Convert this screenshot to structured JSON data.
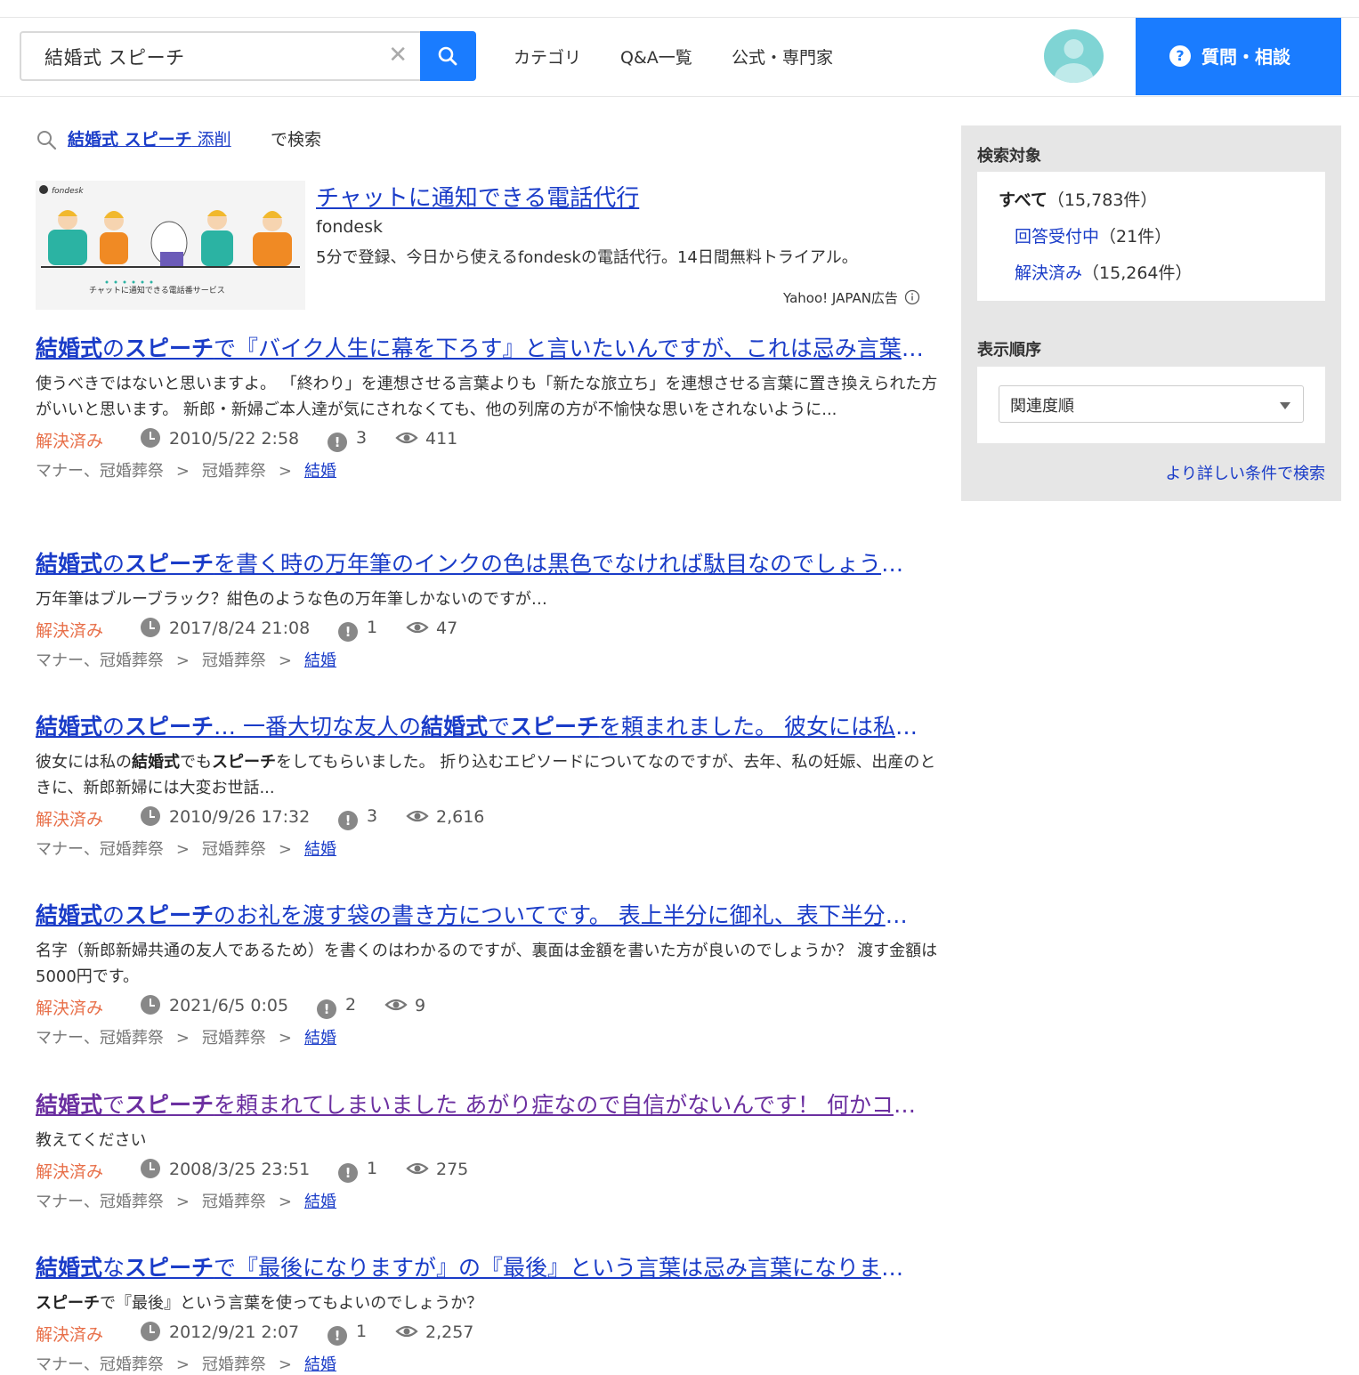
{
  "header": {
    "search_value": "結婚式 スピーチ",
    "nav": [
      "カテゴリ",
      "Q&A一覧",
      "公式・専門家"
    ],
    "ask_label": "質問・相談",
    "ask_icon": "?"
  },
  "suggest": {
    "query_bold": "結婚式 スピーチ",
    "query_rest": " 添削",
    "tail": "で検索"
  },
  "ad": {
    "title": "チャットに通知できる電話代行",
    "brand": "fondesk",
    "description": "5分で登録、今日から使えるfondeskの電話代行。14日間無料トライアル。",
    "label": "Yahoo! JAPAN広告",
    "image_logo": "fondesk",
    "image_caption": "チャットに通知できる電話番サービス"
  },
  "results": [
    {
      "title_html": "<b>結婚式</b>の<b>スピーチ</b>で『バイク人生に幕を下ろす』と言いたいんですが、これは忌み言葉になりますか？",
      "snippet_html": "使うべきではないと思いますよ。 「終わり」を連想させる言葉よりも「新たな旅立ち」を連想させる言葉に置き換えられた方がいいと思います。 新郎・新婦ご本人達が気にされなくても、他の列席の方が不愉快な思いをされないように...",
      "status": "解決済み",
      "date": "2010/5/22 2:58",
      "answers": "3",
      "views": "411",
      "cat1": "マナー、冠婚葬祭",
      "cat2": "冠婚葬祭",
      "cat3": "結婚",
      "visited": false
    },
    {
      "title_html": "<b>結婚式</b>の<b>スピーチ</b>を書く時の万年筆のインクの色は黒色でなければ駄目なのでしょうか？",
      "snippet_html": "万年筆はブルーブラック？紺色のような色の万年筆しかないのですが…",
      "status": "解決済み",
      "date": "2017/8/24 21:08",
      "answers": "1",
      "views": "47",
      "cat1": "マナー、冠婚葬祭",
      "cat2": "冠婚葬祭",
      "cat3": "結婚",
      "visited": false
    },
    {
      "title_html": "<b>結婚式</b>の<b>スピーチ</b>… 一番大切な友人の<b>結婚式</b>で<b>スピーチ</b>を頼まれました。 彼女には私の結婚式でも",
      "snippet_html": "彼女には私の<b>結婚式</b>でも<b>スピーチ</b>をしてもらいました。 折り込むエピソードについてなのですが、去年、私の妊娠、出産のときに、新郎新婦には大変お世話...",
      "status": "解決済み",
      "date": "2010/9/26 17:32",
      "answers": "3",
      "views": "2,616",
      "cat1": "マナー、冠婚葬祭",
      "cat2": "冠婚葬祭",
      "cat3": "結婚",
      "visited": false
    },
    {
      "title_html": "<b>結婚式</b>の<b>スピーチ</b>のお礼を渡す袋の書き方についてです。 表上半分に御礼、表下半分に名字",
      "snippet_html": "名字（新郎新婦共通の友人であるため）を書くのはわかるのですが、裏面は金額を書いた方が良いのでしょうか？ 渡す金額は5000円です。",
      "status": "解決済み",
      "date": "2021/6/5 0:05",
      "answers": "2",
      "views": "9",
      "cat1": "マナー、冠婚葬祭",
      "cat2": "冠婚葬祭",
      "cat3": "結婚",
      "visited": false
    },
    {
      "title_html": "<b>結婚式</b>で<b>スピーチ</b>を頼まれてしまいました あがり症なので自信がないんです！ 何かコツを",
      "snippet_html": "教えてください",
      "status": "解決済み",
      "date": "2008/3/25 23:51",
      "answers": "1",
      "views": "275",
      "cat1": "マナー、冠婚葬祭",
      "cat2": "冠婚葬祭",
      "cat3": "結婚",
      "visited": true
    },
    {
      "title_html": "<b>結婚式</b>な<b>スピーチ</b>で『最後になりますが』の『最後』という言葉は忌み言葉になりますか？",
      "snippet_html": "<b>スピーチ</b>で『最後』という言葉を使ってもよいのでしょうか？",
      "status": "解決済み",
      "date": "2012/9/21 2:07",
      "answers": "1",
      "views": "2,257",
      "cat1": "マナー、冠婚葬祭",
      "cat2": "冠婚葬祭",
      "cat3": "結婚",
      "visited": false
    }
  ],
  "sidebar": {
    "target_heading": "検索対象",
    "opt_all_label": "すべて",
    "opt_all_count": "（15,783件）",
    "opt_open_label": "回答受付中",
    "opt_open_count": "（21件）",
    "opt_solved_label": "解決済み",
    "opt_solved_count": "（15,264件）",
    "order_heading": "表示順序",
    "order_value": "関連度順",
    "more_link": "より詳しい条件で検索"
  },
  "colors": {
    "accent": "#1a7cff",
    "link": "#1a3cc8",
    "status": "#e8704a",
    "visited": "#6b2fa0"
  }
}
